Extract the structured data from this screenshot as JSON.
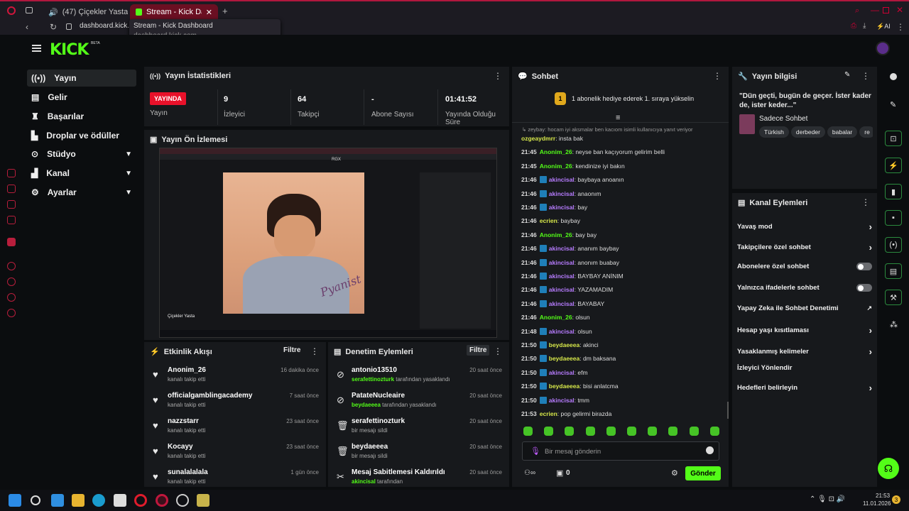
{
  "browser": {
    "tabs": [
      {
        "label": "(47) Çiçekler Yasta - Y"
      },
      {
        "label": "Stream - Kick Dashbo"
      }
    ],
    "url": "dashboard.kick.c",
    "popup_title": "Stream - Kick Dashboard",
    "popup_url": "dashboard.kick.com",
    "ai": "AI"
  },
  "brand": {
    "logo": "KICK",
    "beta": "BETA"
  },
  "nav": [
    {
      "label": "Yayın"
    },
    {
      "label": "Gelir"
    },
    {
      "label": "Başarılar"
    },
    {
      "label": "Droplar ve ödüller"
    },
    {
      "label": "Stüdyo"
    },
    {
      "label": "Kanal"
    },
    {
      "label": "Ayarlar"
    }
  ],
  "stats": {
    "title": "Yayın İstatistikleri",
    "live_badge": "YAYINDA",
    "live_label": "Yayın",
    "viewers": "9",
    "viewers_label": "İzleyici",
    "followers": "64",
    "followers_label": "Takipçi",
    "subs": "-",
    "subs_label": "Abone Sayısı",
    "duration": "01:41:52",
    "duration_label": "Yayında Olduğu Süre"
  },
  "preview": {
    "title": "Yayın Ön İzlemesi",
    "video_title": "Çiçekler Yasta",
    "overlay": "RGX",
    "cover_text": "Pyanist"
  },
  "activity": {
    "title": "Etkinlik Akışı",
    "filter": "Filtre",
    "items": [
      {
        "name": "Anonim_26",
        "desc": "kanalı takip etti",
        "time": "16 dakika önce"
      },
      {
        "name": "officialgamblingacademy",
        "desc": "kanalı takip etti",
        "time": "7 saat önce"
      },
      {
        "name": "nazzstarr",
        "desc": "kanalı takip etti",
        "time": "23 saat önce"
      },
      {
        "name": "Kocayy",
        "desc": "kanalı takip etti",
        "time": "23 saat önce"
      },
      {
        "name": "sunalalalala",
        "desc": "kanalı takip etti",
        "time": "1 gün önce"
      }
    ]
  },
  "moderation": {
    "title": "Denetim Eylemleri",
    "filter": "Filtre",
    "items": [
      {
        "name": "antonio13510",
        "actor": "serafettinozturk",
        "desc": "tarafından yasaklandı",
        "time": "20 saat önce"
      },
      {
        "name": "PatateNucleaire",
        "actor": "beydaeeea",
        "desc": "tarafından yasaklandı",
        "time": "20 saat önce"
      },
      {
        "name": "serafettinozturk",
        "actor": "",
        "desc": "bir mesajı sildi",
        "time": "20 saat önce"
      },
      {
        "name": "beydaeeea",
        "actor": "",
        "desc": "bir mesajı sildi",
        "time": "20 saat önce"
      },
      {
        "name": "Mesaj Sabitlemesi Kaldırıldı",
        "actor": "akincisal",
        "desc": "tarafından",
        "time": "20 saat önce"
      }
    ]
  },
  "chat": {
    "title": "Sohbet",
    "gift_banner": "1 abonelik hediye ederek 1. sıraya yükselin",
    "gift_rank": "1",
    "reply_preview": "zeybay: hocam iyi aksmalar ben kacıom isimli kullanıcıya yanıt veriyor",
    "messages": [
      {
        "time": "",
        "user": "ozgeaydmrr",
        "color": "y",
        "badge": false,
        "text": "insta bak"
      },
      {
        "time": "21:45",
        "user": "Anonim_26",
        "color": "g",
        "badge": false,
        "text": "neyse ban kaçıyorum gelirim belli"
      },
      {
        "time": "21:45",
        "user": "Anonim_26",
        "color": "g",
        "badge": false,
        "text": "kendinize iyi bakın"
      },
      {
        "time": "21:46",
        "user": "akincisal",
        "color": "p",
        "badge": true,
        "text": "baybaya anoanın"
      },
      {
        "time": "21:46",
        "user": "akincisal",
        "color": "p",
        "badge": true,
        "text": "anaonım"
      },
      {
        "time": "21:46",
        "user": "akincisal",
        "color": "p",
        "badge": true,
        "text": "bay"
      },
      {
        "time": "21:46",
        "user": "ecrien",
        "color": "y",
        "badge": false,
        "text": "baybay"
      },
      {
        "time": "21:46",
        "user": "Anonim_26",
        "color": "g",
        "badge": false,
        "text": "bay bay"
      },
      {
        "time": "21:46",
        "user": "akincisal",
        "color": "p",
        "badge": true,
        "text": "ananım baybay"
      },
      {
        "time": "21:46",
        "user": "akincisal",
        "color": "p",
        "badge": true,
        "text": "anonım buabay"
      },
      {
        "time": "21:46",
        "user": "akincisal",
        "color": "p",
        "badge": true,
        "text": "BAYBAY ANİNIM"
      },
      {
        "time": "21:46",
        "user": "akincisal",
        "color": "p",
        "badge": true,
        "text": "YAZAMADIM"
      },
      {
        "time": "21:46",
        "user": "akincisal",
        "color": "p",
        "badge": true,
        "text": "BAYABAY"
      },
      {
        "time": "21:46",
        "user": "Anonim_26",
        "color": "g",
        "badge": false,
        "text": "olsun"
      },
      {
        "time": "21:48",
        "user": "akincisal",
        "color": "p",
        "badge": true,
        "text": "olsun"
      },
      {
        "time": "21:50",
        "user": "beydaeeea",
        "color": "y",
        "badge": true,
        "text": "akinci"
      },
      {
        "time": "21:50",
        "user": "beydaeeea",
        "color": "y",
        "badge": true,
        "text": "dm baksana"
      },
      {
        "time": "21:50",
        "user": "akincisal",
        "color": "p",
        "badge": true,
        "text": "efm"
      },
      {
        "time": "21:50",
        "user": "beydaeeea",
        "color": "y",
        "badge": true,
        "text": "bisi anlatcma"
      },
      {
        "time": "21:50",
        "user": "akincisal",
        "color": "p",
        "badge": true,
        "text": "tmm"
      },
      {
        "time": "21:53",
        "user": "ecrien",
        "color": "y",
        "badge": false,
        "text": "pop gelirmi birazda"
      }
    ],
    "input_placeholder": "Bir mesaj gönderin",
    "points": "0",
    "send": "Gönder"
  },
  "stream_info": {
    "title": "Yayın bilgisi",
    "stream_title": "\"Dün geçti, bugün de geçer. İster kader de, ister keder...\"",
    "category": "Sadece Sohbet",
    "tags": [
      "Türkish",
      "derbeder",
      "babalar",
      "re"
    ]
  },
  "channel_actions": {
    "title": "Kanal Eylemleri",
    "items": [
      {
        "label": "Yavaş mod",
        "control": "chevron"
      },
      {
        "label": "Takipçilere özel sohbet",
        "control": "chevron"
      },
      {
        "label": "Abonelere özel sohbet",
        "control": "toggle"
      },
      {
        "label": "Yalnızca ifadelerle sohbet",
        "control": "toggle"
      },
      {
        "label": "Yapay Zeka ile Sohbet Denetimi",
        "control": "external"
      },
      {
        "label": "Hesap yaşı kısıtlaması",
        "control": "chevron"
      },
      {
        "label": "Yasaklanmış kelimeler",
        "control": "chevron"
      },
      {
        "label": "İzleyici Yönlendir",
        "control": "none"
      },
      {
        "label": "Hedefleri belirleyin",
        "control": "chevron"
      }
    ]
  },
  "taskbar": {
    "time": "21:53",
    "date": "11.01.2026",
    "notif": "3"
  }
}
